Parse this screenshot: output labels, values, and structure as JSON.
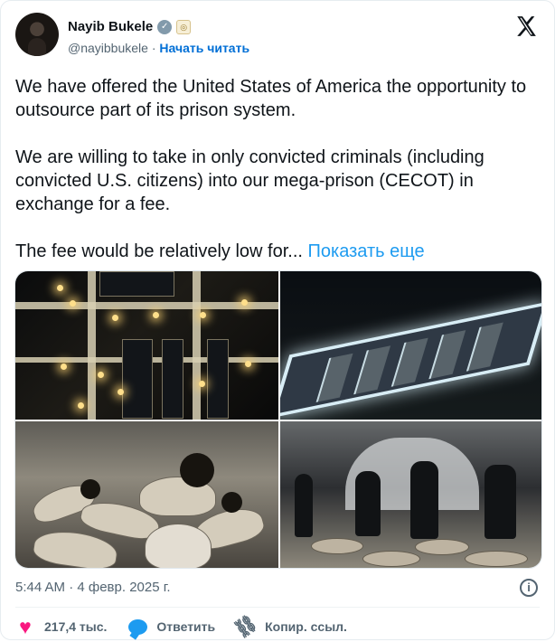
{
  "author": {
    "name": "Nayib Bukele",
    "handle": "@nayibbukele",
    "separator": "·",
    "follow_label": "Начать читать",
    "verified_icon": "verified-check-icon",
    "affiliate_icon": "government-seal-icon"
  },
  "brand": {
    "logo_icon": "x-logo-icon"
  },
  "tweet": {
    "paragraph1": "We have offered the United States of America the opportunity to outsource part of its prison system.",
    "paragraph2": "We are willing to take in only convicted criminals (including convicted U.S. citizens) into our mega-prison (CECOT) in exchange for a fee.",
    "paragraph3": "The fee would be relatively low for...",
    "show_more": "Показать еще"
  },
  "media": {
    "images": [
      "aerial prison night image",
      "prison complex lights image",
      "inmates crowded image",
      "guards and inmates hall image"
    ]
  },
  "meta": {
    "timestamp": "5:44 AM · 4 февр. 2025 г.",
    "info_icon": "info-icon"
  },
  "actions": {
    "likes": "217,4 тыс.",
    "reply_label": "Ответить",
    "copy_label": "Копир. ссыл."
  },
  "colors": {
    "brand_blue": "#1d9bf0",
    "like_pink": "#f91880",
    "muted_text": "#536471"
  }
}
